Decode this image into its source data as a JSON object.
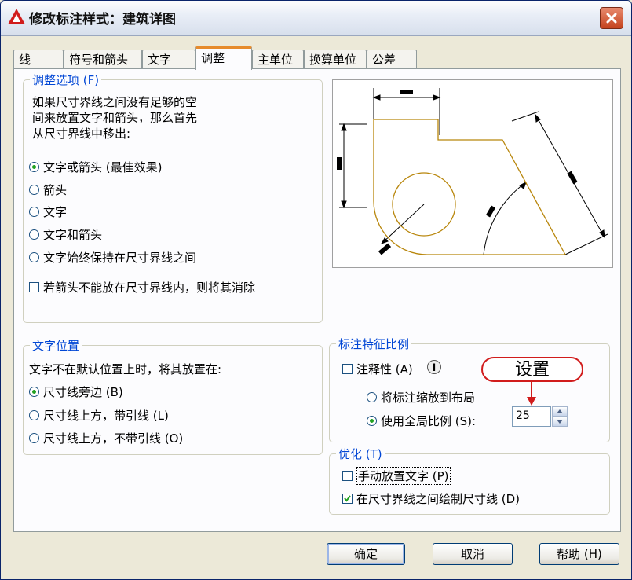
{
  "window": {
    "title": "修改标注样式：建筑详图",
    "close_label": "✕"
  },
  "tabs": [
    "线",
    "符号和箭头",
    "文字",
    "调整",
    "主单位",
    "换算单位",
    "公差"
  ],
  "fit_options": {
    "legend": "调整选项 (F)",
    "description": [
      "如果尺寸界线之间没有足够的空",
      "间来放置文字和箭头，那么首先",
      "从尺寸界线中移出:"
    ],
    "radios": [
      "文字或箭头 (最佳效果)",
      "箭头",
      "文字",
      "文字和箭头",
      "文字始终保持在尺寸界线之间"
    ],
    "selected": 0,
    "suppress_checkbox": "若箭头不能放在尺寸界线内，则将其消除"
  },
  "text_placement": {
    "legend": "文字位置",
    "description": "文字不在默认位置上时，将其放置在:",
    "radios": [
      "尺寸线旁边 (B)",
      "尺寸线上方，带引线 (L)",
      "尺寸线上方，不带引线 (O)"
    ],
    "selected": 0
  },
  "scale": {
    "legend": "标注特征比例",
    "annotative_label": "注释性 (A)",
    "info_icon": "i",
    "radio_layout": "将标注缩放到布局",
    "radio_global": "使用全局比例 (S):",
    "global_value": "25",
    "callout": "设置"
  },
  "fine_tuning": {
    "legend": "优化 (T)",
    "manual_text": "手动放置文字 (P)",
    "draw_dimline": "在尺寸界线之间绘制尺寸线 (D)"
  },
  "buttons": {
    "ok": "确定",
    "cancel": "取消",
    "help": "帮助 (H)"
  },
  "colors": {
    "accent": "#0046d5",
    "shape": "#b8860b",
    "callout": "#d11c1c"
  }
}
